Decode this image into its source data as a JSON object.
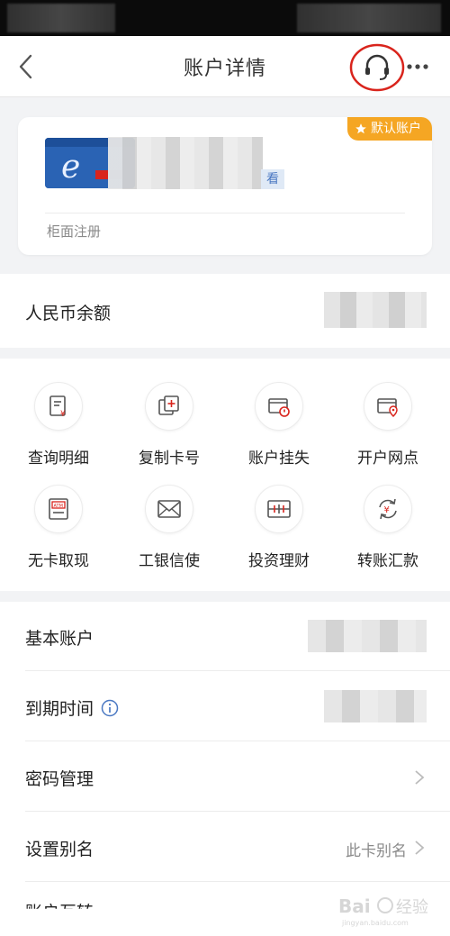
{
  "header": {
    "title": "账户详情"
  },
  "card": {
    "default_badge": "默认账户",
    "view_label": "看",
    "footer": "柜面注册"
  },
  "balance": {
    "label": "人民币余额"
  },
  "functions": [
    {
      "label": "查询明细",
      "icon": "statement-icon"
    },
    {
      "label": "复制卡号",
      "icon": "copy-card-icon"
    },
    {
      "label": "账户挂失",
      "icon": "report-loss-icon"
    },
    {
      "label": "开户网点",
      "icon": "branch-location-icon"
    },
    {
      "label": "无卡取现",
      "icon": "atm-icon"
    },
    {
      "label": "工银信使",
      "icon": "envelope-icon"
    },
    {
      "label": "投资理财",
      "icon": "investment-icon"
    },
    {
      "label": "转账汇款",
      "icon": "transfer-icon"
    }
  ],
  "list": {
    "basic_account": "基本账户",
    "expiry": "到期时间",
    "password": "密码管理",
    "alias_label": "设置别名",
    "alias_value": "此卡别名",
    "partial": "账户互转"
  },
  "colors": {
    "badge": "#f5a623",
    "highlight_circle": "#d9241c",
    "accent_red": "#d9241c",
    "link_blue": "#4a78c2"
  }
}
